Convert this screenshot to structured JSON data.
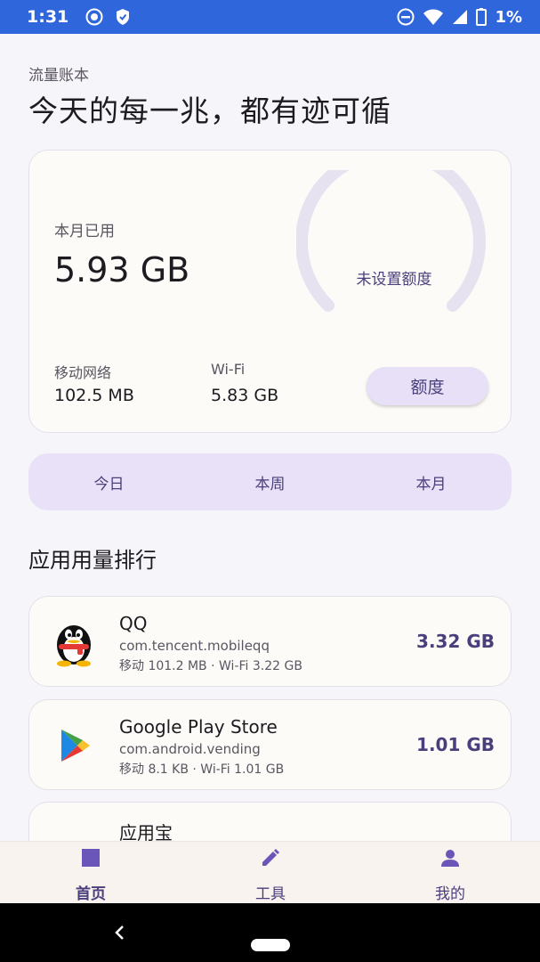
{
  "status_bar": {
    "time": "1:31",
    "battery": "1%",
    "icons": [
      "record-icon",
      "shield-icon",
      "do-not-disturb-icon",
      "wifi-icon",
      "signal-icon",
      "battery-icon"
    ]
  },
  "header": {
    "subtitle": "流量账本",
    "title": "今天的每一兆，都有迹可循"
  },
  "summary": {
    "used_label": "本月已用",
    "used_value": "5.93 GB",
    "gauge_text": "未设置额度",
    "mobile_label": "移动网络",
    "mobile_value": "102.5 MB",
    "wifi_label": "Wi-Fi",
    "wifi_value": "5.83 GB",
    "quota_button": "额度"
  },
  "period_tabs": [
    "今日",
    "本周",
    "本月"
  ],
  "section_title": "应用用量排行",
  "apps": [
    {
      "name": "QQ",
      "package": "com.tencent.mobileqq",
      "detail": "移动 101.2 MB · Wi-Fi 3.22 GB",
      "total": "3.32 GB",
      "icon": "qq-penguin-icon"
    },
    {
      "name": "Google Play Store",
      "package": "com.android.vending",
      "detail": "移动 8.1 KB · Wi-Fi 1.01 GB",
      "total": "1.01 GB",
      "icon": "google-play-icon"
    },
    {
      "name": "应用宝",
      "package": "",
      "detail": "",
      "total": "",
      "icon": "yingyongbao-icon"
    }
  ],
  "bottom_nav": [
    {
      "label": "首页",
      "icon": "home-square-icon",
      "active": true
    },
    {
      "label": "工具",
      "icon": "pencil-icon",
      "active": false
    },
    {
      "label": "我的",
      "icon": "person-icon",
      "active": false
    }
  ],
  "colors": {
    "status_bar": "#2f66dc",
    "accent": "#4a3f7c",
    "background": "#f6f5fa",
    "card": "#fdfbf8",
    "chip": "#e8e1f7"
  }
}
